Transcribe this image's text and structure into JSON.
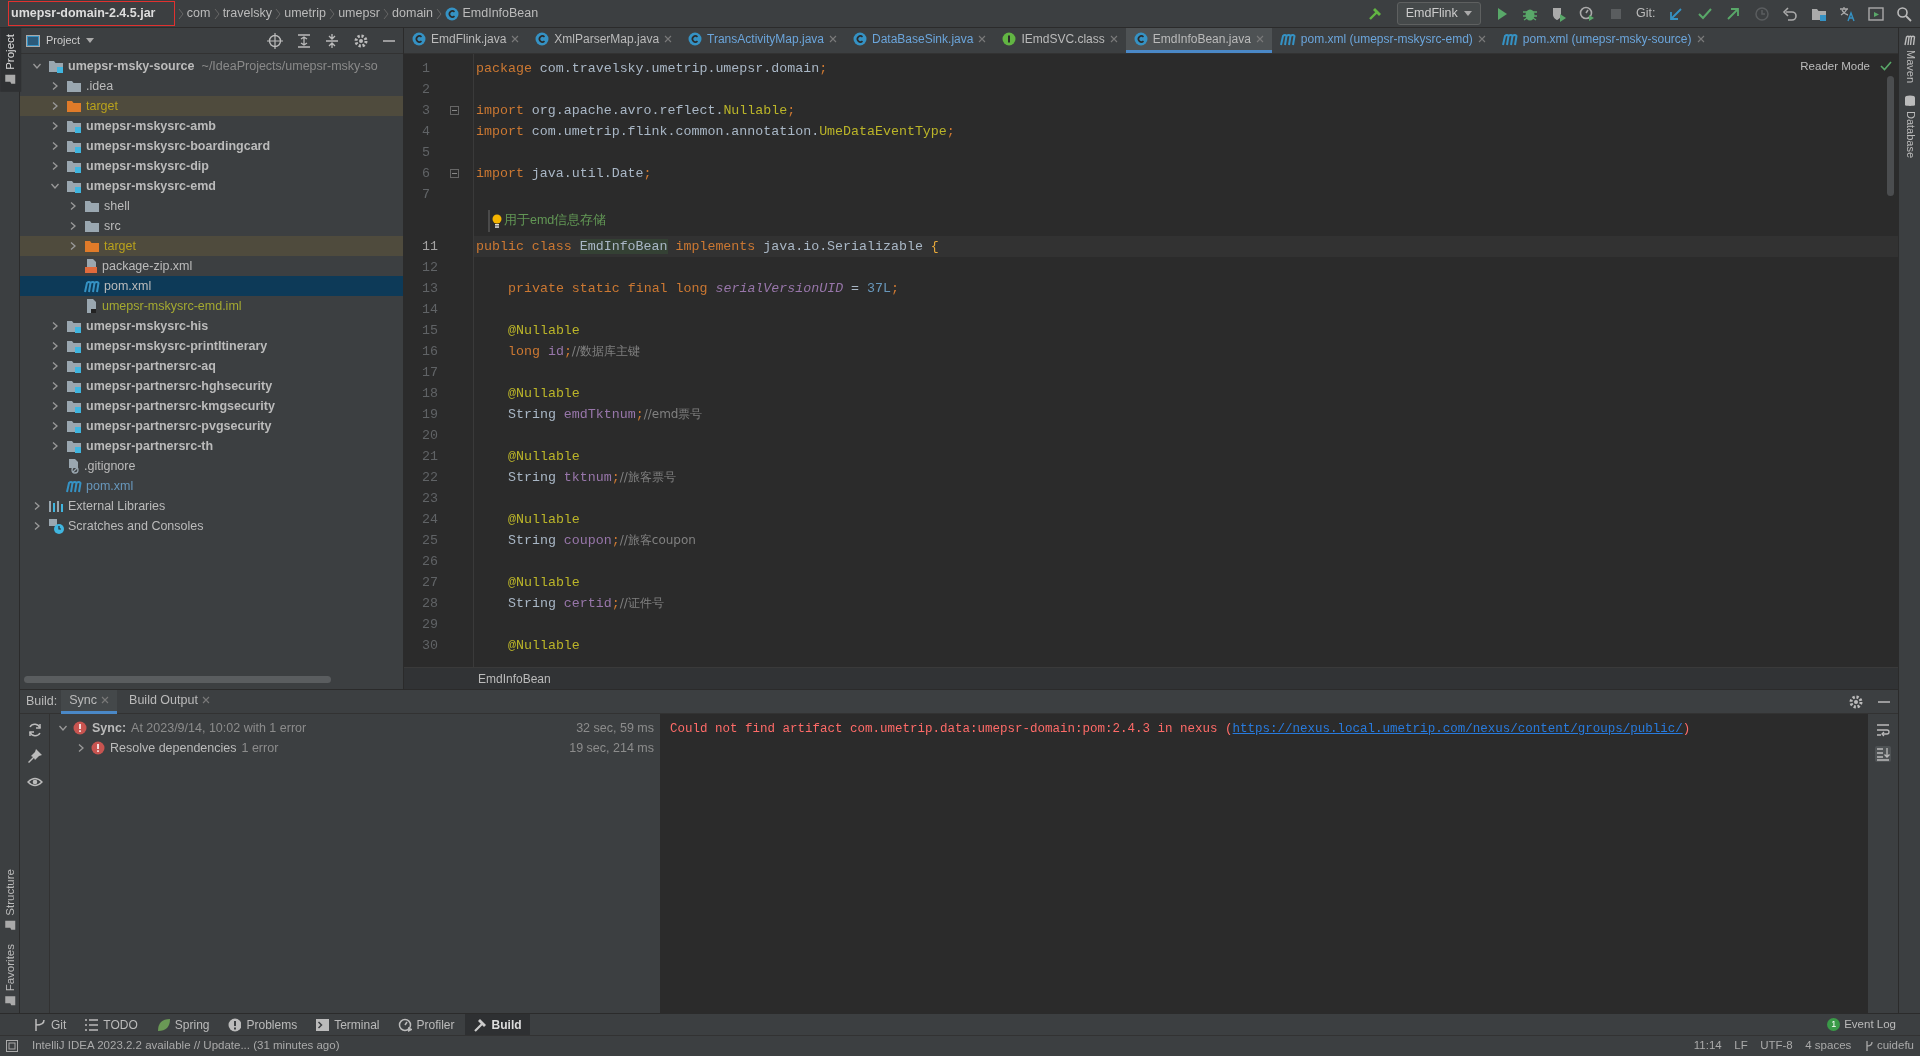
{
  "breadcrumb": [
    {
      "text": "umepsr-domain-2.4.5.jar",
      "kind": "jar",
      "highlighted": true
    },
    {
      "text": "com",
      "kind": "package",
      "highlighted": false
    },
    {
      "text": "travelsky",
      "kind": "package",
      "highlighted": false
    },
    {
      "text": "umetrip",
      "kind": "package",
      "highlighted": false
    },
    {
      "text": "umepsr",
      "kind": "package",
      "highlighted": false
    },
    {
      "text": "domain",
      "kind": "package",
      "highlighted": false
    },
    {
      "text": "EmdInfoBean",
      "kind": "class",
      "highlighted": false
    }
  ],
  "toolbar": {
    "run_config": "EmdFlink",
    "git_label": "Git:"
  },
  "left_stripe_top": [
    {
      "label": "Project",
      "selected": true
    }
  ],
  "left_stripe_bottom": [
    {
      "label": "Structure",
      "selected": false
    },
    {
      "label": "Favorites",
      "selected": false
    }
  ],
  "project_panel": {
    "title": "Project",
    "tree": [
      {
        "label": "umepsr-msky-source",
        "hint": "~/IdeaProjects/umepsr-msky-so",
        "kind": "module",
        "expanded": true,
        "selected": false,
        "children": [
          {
            "label": ".idea",
            "kind": "folder",
            "expanded": false,
            "selected": false
          },
          {
            "label": "target",
            "kind": "excluded",
            "expanded": false,
            "selected": false
          },
          {
            "label": "umepsr-mskysrc-amb",
            "kind": "module",
            "expanded": false,
            "selected": false
          },
          {
            "label": "umepsr-mskysrc-boardingcard",
            "kind": "module",
            "expanded": false,
            "selected": false
          },
          {
            "label": "umepsr-mskysrc-dip",
            "kind": "module",
            "expanded": false,
            "selected": false
          },
          {
            "label": "umepsr-mskysrc-emd",
            "kind": "module",
            "expanded": true,
            "selected": false,
            "children": [
              {
                "label": "shell",
                "kind": "folder",
                "expanded": false,
                "selected": false
              },
              {
                "label": "src",
                "kind": "folder",
                "expanded": false,
                "selected": false
              },
              {
                "label": "target",
                "kind": "excluded",
                "expanded": false,
                "selected": false
              },
              {
                "label": "package-zip.xml",
                "kind": "xml",
                "selected": false
              },
              {
                "label": "pom.xml",
                "kind": "maven",
                "selected": true
              },
              {
                "label": "umepsr-mskysrc-emd.iml",
                "kind": "iml",
                "color": "#a4a931",
                "selected": false
              }
            ]
          },
          {
            "label": "umepsr-mskysrc-his",
            "kind": "module",
            "expanded": false,
            "selected": false
          },
          {
            "label": "umepsr-mskysrc-printItinerary",
            "kind": "module",
            "expanded": false,
            "selected": false
          },
          {
            "label": "umepsr-partnersrc-aq",
            "kind": "module",
            "expanded": false,
            "selected": false
          },
          {
            "label": "umepsr-partnersrc-hghsecurity",
            "kind": "module",
            "expanded": false,
            "selected": false
          },
          {
            "label": "umepsr-partnersrc-kmgsecurity",
            "kind": "module",
            "expanded": false,
            "selected": false
          },
          {
            "label": "umepsr-partnersrc-pvgsecurity",
            "kind": "module",
            "expanded": false,
            "selected": false
          },
          {
            "label": "umepsr-partnersrc-th",
            "kind": "module",
            "expanded": false,
            "selected": false
          },
          {
            "label": ".gitignore",
            "kind": "gitignore",
            "selected": false
          },
          {
            "label": "pom.xml",
            "kind": "maven",
            "color": "#6897bb",
            "selected": false
          }
        ]
      },
      {
        "label": "External Libraries",
        "kind": "libraries",
        "expanded": false,
        "selected": false
      },
      {
        "label": "Scratches and Consoles",
        "kind": "scratches",
        "expanded": false,
        "selected": false
      }
    ]
  },
  "editor": {
    "tabs": [
      {
        "label": "EmdFlink.java",
        "kind": "class",
        "modified": false,
        "selected": false
      },
      {
        "label": "XmlParserMap.java",
        "kind": "class",
        "modified": false,
        "selected": false
      },
      {
        "label": "TransActivityMap.java",
        "kind": "class",
        "modified": true,
        "selected": false
      },
      {
        "label": "DataBaseSink.java",
        "kind": "class",
        "modified": true,
        "selected": false
      },
      {
        "label": "IEmdSVC.class",
        "kind": "interface",
        "modified": false,
        "selected": false
      },
      {
        "label": "EmdInfoBean.java",
        "kind": "class",
        "modified": false,
        "selected": true
      },
      {
        "label": "pom.xml (umepsr-mskysrc-emd)",
        "kind": "maven",
        "modified": true,
        "selected": false
      },
      {
        "label": "pom.xml (umepsr-msky-source)",
        "kind": "maven",
        "modified": true,
        "selected": false
      }
    ],
    "reader_mode": "Reader Mode",
    "lines": [
      {
        "number": "1",
        "tokens": [
          {
            "kind": "kw",
            "text": "package"
          },
          {
            "kind": "plain",
            "text": " com.travelsky.umetrip.umepsr.domain"
          },
          {
            "kind": "punct",
            "text": ";"
          }
        ]
      },
      {
        "number": "2"
      },
      {
        "number": "3",
        "fold": true,
        "tokens": [
          {
            "kind": "kw",
            "text": "import"
          },
          {
            "kind": "plain",
            "text": " org.apache.avro.reflect."
          },
          {
            "kind": "type",
            "text": "Nullable"
          },
          {
            "kind": "punct",
            "text": ";"
          }
        ]
      },
      {
        "number": "4",
        "tokens": [
          {
            "kind": "kw",
            "text": "import"
          },
          {
            "kind": "plain",
            "text": " com.umetrip.flink.common.annotation."
          },
          {
            "kind": "type",
            "text": "UmeDataEventType"
          },
          {
            "kind": "punct",
            "text": ";"
          }
        ]
      },
      {
        "number": "5"
      },
      {
        "number": "6",
        "fold": true,
        "tokens": [
          {
            "kind": "kw",
            "text": "import"
          },
          {
            "kind": "plain",
            "text": " java.util.Date"
          },
          {
            "kind": "punct",
            "text": ";"
          }
        ]
      },
      {
        "number": "7"
      },
      {
        "kind": "doc",
        "text": "用于emd信息存储"
      },
      {
        "number": "11",
        "current": true,
        "tokens": [
          {
            "kind": "kw",
            "text": "public class "
          },
          {
            "kind": "usage",
            "text": "EmdInfoBean"
          },
          {
            "kind": "kw",
            "text": " implements"
          },
          {
            "kind": "plain",
            "text": " java.io.Serializable "
          },
          {
            "kind": "brace",
            "text": "{"
          }
        ]
      },
      {
        "number": "12"
      },
      {
        "number": "13",
        "indented": true,
        "tokens": [
          {
            "kind": "kw",
            "text": "private static final long "
          },
          {
            "kind": "static",
            "text": "serialVersionUID"
          },
          {
            "kind": "plain",
            "text": " = "
          },
          {
            "kind": "num",
            "text": "37L"
          },
          {
            "kind": "punct",
            "text": ";"
          }
        ]
      },
      {
        "number": "14"
      },
      {
        "number": "15",
        "indented": true,
        "tokens": [
          {
            "kind": "ann",
            "text": "@Nullable"
          }
        ]
      },
      {
        "number": "16",
        "indented": true,
        "tokens": [
          {
            "kind": "kw",
            "text": "long "
          },
          {
            "kind": "field",
            "text": "id"
          },
          {
            "kind": "punct",
            "text": ";"
          },
          {
            "kind": "comment",
            "text": "//数据库主键"
          }
        ]
      },
      {
        "number": "17"
      },
      {
        "number": "18",
        "indented": true,
        "tokens": [
          {
            "kind": "ann",
            "text": "@Nullable"
          }
        ]
      },
      {
        "number": "19",
        "indented": true,
        "tokens": [
          {
            "kind": "plain",
            "text": "String "
          },
          {
            "kind": "field",
            "text": "emdTktnum"
          },
          {
            "kind": "punct",
            "text": ";"
          },
          {
            "kind": "comment",
            "text": "//emd票号"
          }
        ]
      },
      {
        "number": "20"
      },
      {
        "number": "21",
        "indented": true,
        "tokens": [
          {
            "kind": "ann",
            "text": "@Nullable"
          }
        ]
      },
      {
        "number": "22",
        "indented": true,
        "tokens": [
          {
            "kind": "plain",
            "text": "String "
          },
          {
            "kind": "field",
            "text": "tktnum"
          },
          {
            "kind": "punct",
            "text": ";"
          },
          {
            "kind": "comment",
            "text": "//旅客票号"
          }
        ]
      },
      {
        "number": "23"
      },
      {
        "number": "24",
        "indented": true,
        "tokens": [
          {
            "kind": "ann",
            "text": "@Nullable"
          }
        ]
      },
      {
        "number": "25",
        "indented": true,
        "tokens": [
          {
            "kind": "plain",
            "text": "String "
          },
          {
            "kind": "field",
            "text": "coupon"
          },
          {
            "kind": "punct",
            "text": ";"
          },
          {
            "kind": "comment",
            "text": "//旅客coupon"
          }
        ]
      },
      {
        "number": "26"
      },
      {
        "number": "27",
        "indented": true,
        "tokens": [
          {
            "kind": "ann",
            "text": "@Nullable"
          }
        ]
      },
      {
        "number": "28",
        "indented": true,
        "tokens": [
          {
            "kind": "plain",
            "text": "String "
          },
          {
            "kind": "field",
            "text": "certid"
          },
          {
            "kind": "punct",
            "text": ";"
          },
          {
            "kind": "comment",
            "text": "//证件号"
          }
        ]
      },
      {
        "number": "29"
      },
      {
        "number": "30",
        "indented": true,
        "tokens": [
          {
            "kind": "ann",
            "text": "@Nullable"
          }
        ]
      }
    ],
    "footer": "EmdInfoBean"
  },
  "right_stripe": [
    {
      "label": "Maven",
      "kind": "maven"
    },
    {
      "label": "Database",
      "kind": "database"
    }
  ],
  "build": {
    "title": "Build:",
    "tabs": [
      {
        "label": "Sync",
        "selected": true
      },
      {
        "label": "Build Output",
        "selected": false
      }
    ],
    "tree": [
      {
        "label": "Sync:",
        "detail": "At 2023/9/14, 10:02 with 1 error",
        "time": "32 sec, 59 ms",
        "expanded": true,
        "selected": false,
        "children": [
          {
            "label": "Resolve dependencies",
            "detail": "1 error",
            "time": "19 sec, 214 ms",
            "expanded": false,
            "selected": false
          }
        ]
      }
    ],
    "console": {
      "text": "Could not find artifact com.umetrip.data:umepsr-domain:pom:2.4.3 in nexus (",
      "link": "https://nexus.local.umetrip.com/nexus/content/groups/public/",
      "text_after": ")"
    }
  },
  "tool_windows": [
    {
      "label": "Git",
      "kind": "git",
      "selected": false
    },
    {
      "label": "TODO",
      "kind": "todo",
      "selected": false
    },
    {
      "label": "Spring",
      "kind": "spring",
      "selected": false
    },
    {
      "label": "Problems",
      "kind": "problems",
      "selected": false
    },
    {
      "label": "Terminal",
      "kind": "terminal",
      "selected": false
    },
    {
      "label": "Profiler",
      "kind": "profiler",
      "selected": false
    },
    {
      "label": "Build",
      "kind": "build",
      "selected": true
    }
  ],
  "event_log": {
    "label": "Event Log",
    "count": "1"
  },
  "status_bar": {
    "message": "IntelliJ IDEA 2023.2.2 available // Update... (31 minutes ago)",
    "items": [
      {
        "text": "11:14",
        "kind": "text"
      },
      {
        "text": "LF",
        "kind": "text"
      },
      {
        "text": "UTF-8",
        "kind": "text"
      },
      {
        "text": "4 spaces",
        "kind": "text"
      },
      {
        "text": "cuidefu",
        "kind": "vcs"
      }
    ]
  }
}
